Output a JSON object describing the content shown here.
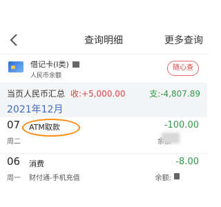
{
  "header": {
    "title": "查询明细",
    "more": "更多查询",
    "back_icon": "chevron-left-icon"
  },
  "card": {
    "name": "借记卡(Ⅰ类)",
    "sub": "人民币余额",
    "balance_button": "随心查",
    "icon": "bank-card-icon"
  },
  "summary": {
    "label": "当页人民币汇总",
    "income": "收:+5,000.00",
    "expense": "支:-4,807.89"
  },
  "month": "2021年12月",
  "transactions": [
    {
      "day": "07",
      "weekday": "周二",
      "title": "ATM取款",
      "subtitle": "",
      "amount": "-100.00",
      "balance_label": "余额"
    },
    {
      "day": "06",
      "weekday": "周一",
      "title": "消费",
      "subtitle": "财付通-手机充值",
      "amount": "-8.00",
      "balance_label": "余额:"
    }
  ],
  "colors": {
    "accent_red": "#d84343",
    "income_red": "#d64545",
    "expense_green": "#2e9a48",
    "month_blue": "#3e6bc7",
    "highlight_orange": "#ff8a12"
  }
}
